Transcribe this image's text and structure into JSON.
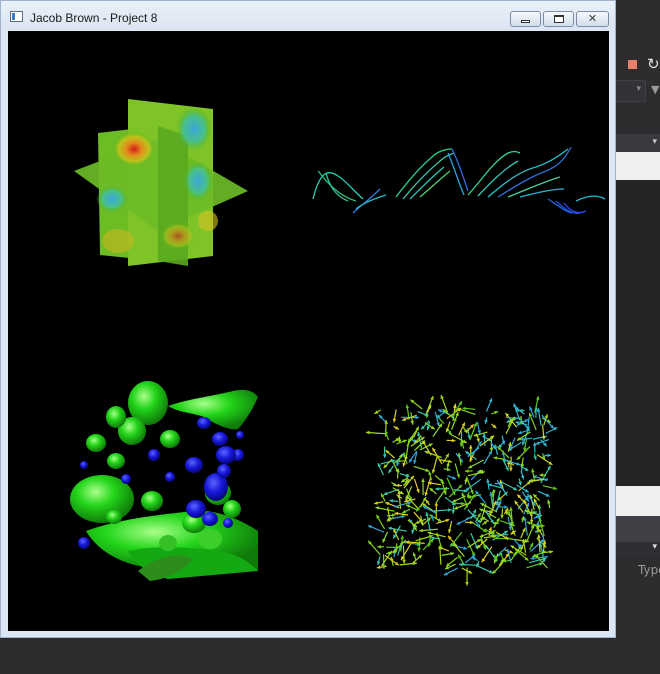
{
  "window": {
    "title": "Jacob Brown - Project 8",
    "controls": {
      "minimize": "minimize",
      "maximize": "maximize",
      "close": "close"
    }
  },
  "viewport": {
    "background": "#000000",
    "panels": [
      {
        "id": "slice-planes",
        "icon": "orthogonal-slice-planes"
      },
      {
        "id": "streamlines",
        "icon": "streamlines"
      },
      {
        "id": "isosurfaces",
        "icon": "isosurface-blobs"
      },
      {
        "id": "vector-glyphs",
        "icon": "arrow-glyph-field"
      }
    ]
  },
  "background_app": {
    "type_label": "Type",
    "colors": {
      "stop": "#e8806a",
      "panel": "#252526",
      "toolbar": "#2d2d30"
    }
  }
}
